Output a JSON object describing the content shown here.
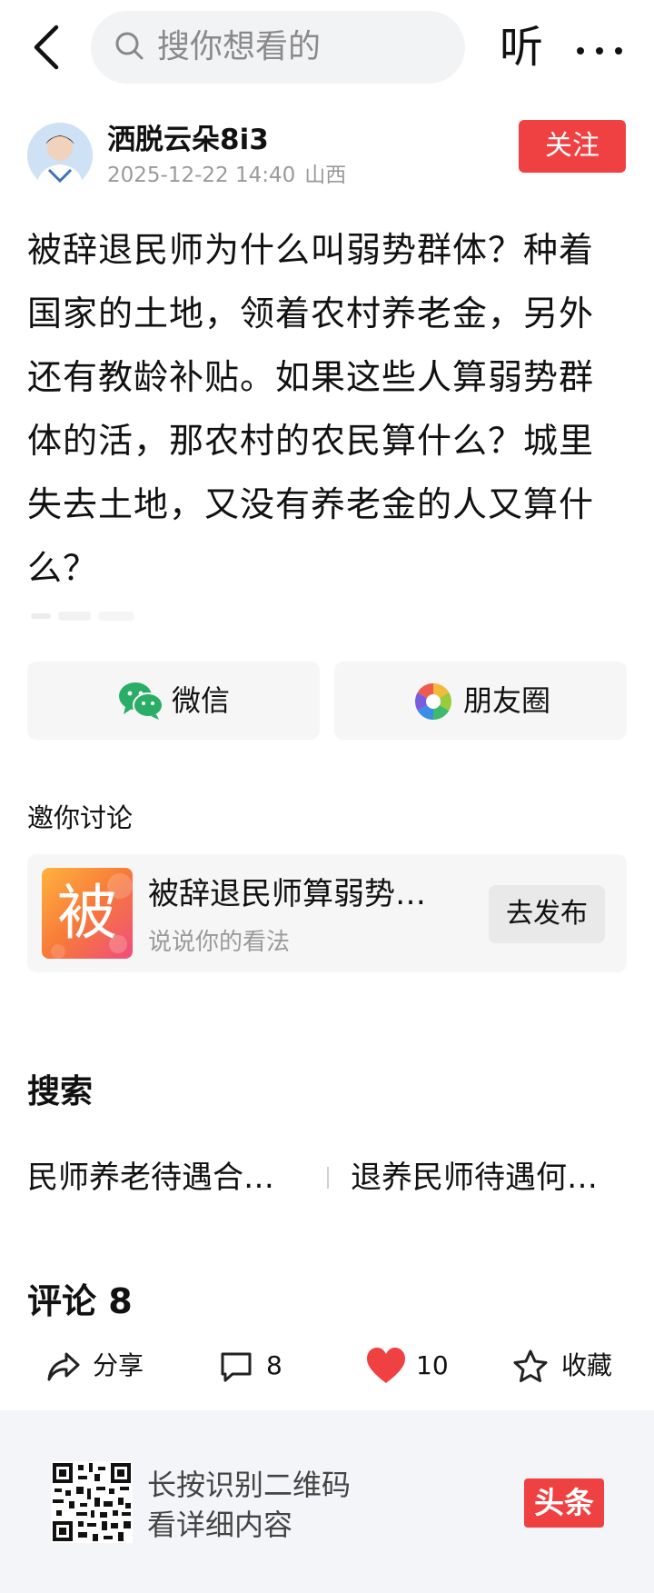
{
  "search": {
    "placeholder": "搜你想看的"
  },
  "header": {
    "listen_label": "听"
  },
  "author": {
    "name": "洒脱云朵8i3",
    "date": "2025-12-22 14:40",
    "location": "山西",
    "follow_label": "关注"
  },
  "post": {
    "body": "被辞退民师为什么叫弱势群体？种着国家的土地，领着农村养老金，另外还有教龄补贴。如果这些人算弱势群体的活，那农村的农民算什么？城里失去土地，又没有养老金的人又算什么？"
  },
  "share": {
    "wechat_label": "微信",
    "moments_label": "朋友圈"
  },
  "invite": {
    "title": "邀你讨论",
    "thumb_char": "被",
    "topic_title": "被辞退民师算弱势…",
    "topic_subtitle": "说说你的看法",
    "publish_label": "去发布"
  },
  "search_section": {
    "title": "搜索",
    "suggestions": [
      "民师养老待遇合…",
      "退养民师待遇何…"
    ]
  },
  "comments": {
    "title": "评论 8"
  },
  "actions": {
    "share_label": "分享",
    "comment_count": "8",
    "like_count": "10",
    "favorite_label": "收藏",
    "like_color": "#f04142"
  },
  "banner": {
    "line1": "长按识别二维码",
    "line2": "看详细内容",
    "logo_text": "头条"
  },
  "colors": {
    "accent": "#f04142"
  }
}
